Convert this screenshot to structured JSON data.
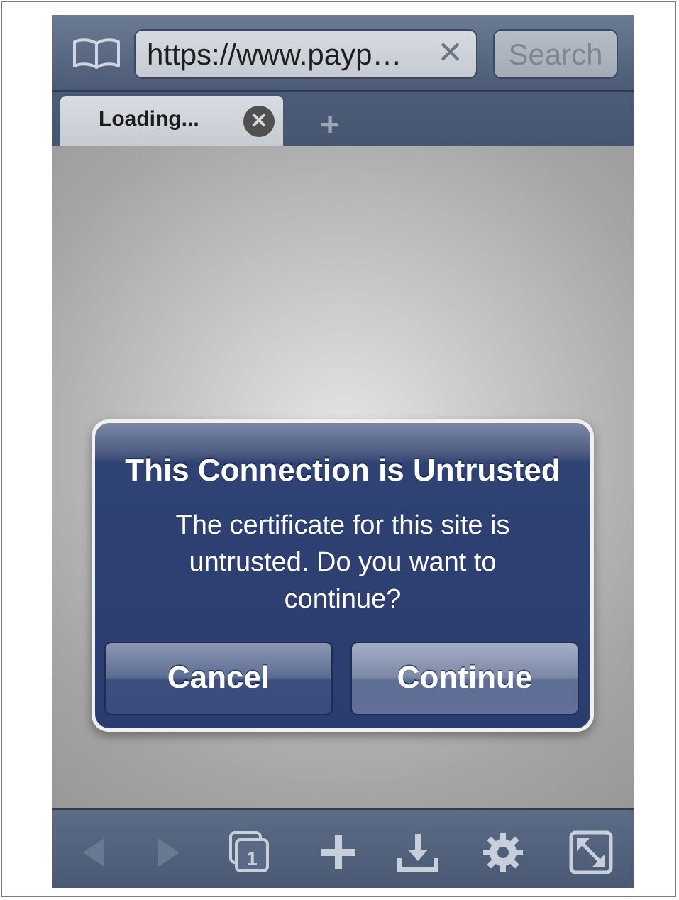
{
  "toolbar_top": {
    "url": "https://www.payp…",
    "clear_glyph": "✕",
    "search_placeholder": "Search",
    "bookmarks_icon": "book-icon"
  },
  "tabs": {
    "items": [
      {
        "title": "Loading...",
        "close_glyph": "✕"
      }
    ],
    "new_tab_glyph": "+"
  },
  "dialog": {
    "title": "This Connection is Untrusted",
    "message": "The certificate for this site is\nuntrusted.   Do you want to\ncontinue?",
    "cancel_label": "Cancel",
    "continue_label": "Continue"
  },
  "toolbar_bottom": {
    "icons": [
      "back-arrow-icon",
      "forward-arrow-icon",
      "tabs-icon",
      "plus-icon",
      "download-icon",
      "gear-icon",
      "fullscreen-icon"
    ],
    "tabs_count": "1"
  },
  "colors": {
    "bar": "#4b5b76",
    "dialog": "#2b3d6e",
    "dialog_border": "#f0f0f0"
  }
}
